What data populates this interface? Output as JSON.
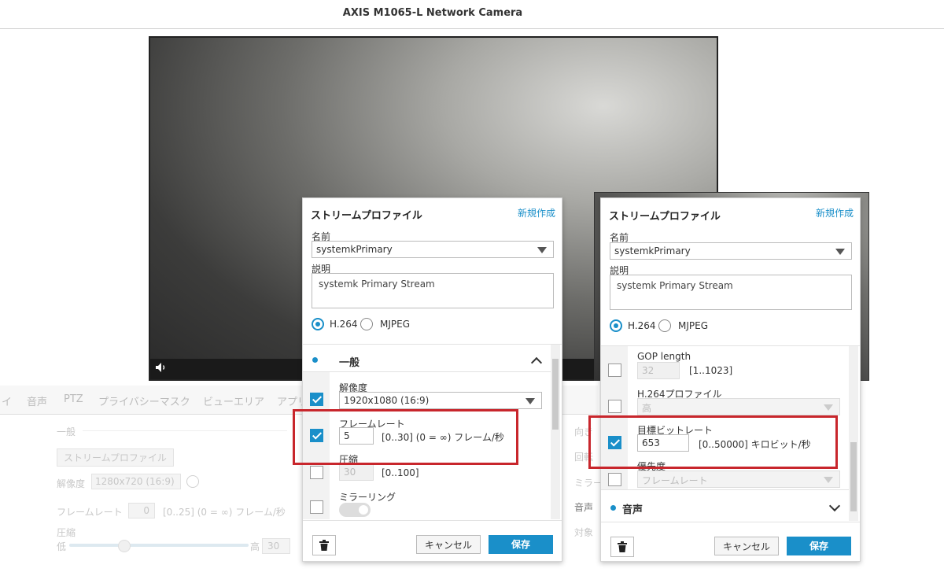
{
  "header": {
    "title": "AXIS M1065-L Network Camera"
  },
  "video": {
    "volume_icon": "speaker-icon"
  },
  "background": {
    "tabs": [
      "イ",
      "音声",
      "PTZ",
      "プライバシーマスク",
      "ビューエリア",
      "アプリ"
    ],
    "section_general": "一般",
    "stream_profile_button": "ストリームプロファイル",
    "resolution_label": "解像度",
    "resolution_value": "1280x720 (16:9)",
    "framerate_label": "フレームレート",
    "framerate_value": "0",
    "framerate_hint": "[0..25] (0 = ∞) フレーム/秒",
    "compression_label": "圧縮",
    "low": "低",
    "high": "高",
    "compression_value": "30",
    "right_labels": [
      "向き",
      "回転",
      "ミラー",
      "音声",
      "対象"
    ]
  },
  "panel_left": {
    "title": "ストリームプロファイル",
    "new_link": "新規作成",
    "name_label": "名前",
    "name_value": "systemkPrimary",
    "desc_label": "説明",
    "desc_value": "systemk Primary Stream",
    "codec_h264": "H.264",
    "codec_mjpeg": "MJPEG",
    "section_title": "一般",
    "resolution_label": "解像度",
    "resolution_value": "1920x1080 (16:9)",
    "framerate_label": "フレームレート",
    "framerate_value": "5",
    "framerate_hint": "[0..30] (0 = ∞) フレーム/秒",
    "compression_label": "圧縮",
    "compression_value": "30",
    "compression_hint": "[0..100]",
    "mirror_label": "ミラーリング",
    "cancel": "キャンセル",
    "save": "保存"
  },
  "panel_right": {
    "title": "ストリームプロファイル",
    "new_link": "新規作成",
    "name_label": "名前",
    "name_value": "systemkPrimary",
    "desc_label": "説明",
    "desc_value": "systemk Primary Stream",
    "codec_h264": "H.264",
    "codec_mjpeg": "MJPEG",
    "gop_label": "GOP length",
    "gop_value": "32",
    "gop_hint": "[1..1023]",
    "h264_profile_label": "H.264プロファイル",
    "h264_profile_value": "高",
    "bitrate_label": "目標ビットレート",
    "bitrate_value": "653",
    "bitrate_hint": "[0..50000] キロビット/秒",
    "priority_label": "優先度",
    "priority_value": "フレームレート",
    "audio_section": "音声",
    "cancel": "キャンセル",
    "save": "保存"
  },
  "colors": {
    "accent": "#1a8fc9",
    "highlight": "#c8262c"
  }
}
